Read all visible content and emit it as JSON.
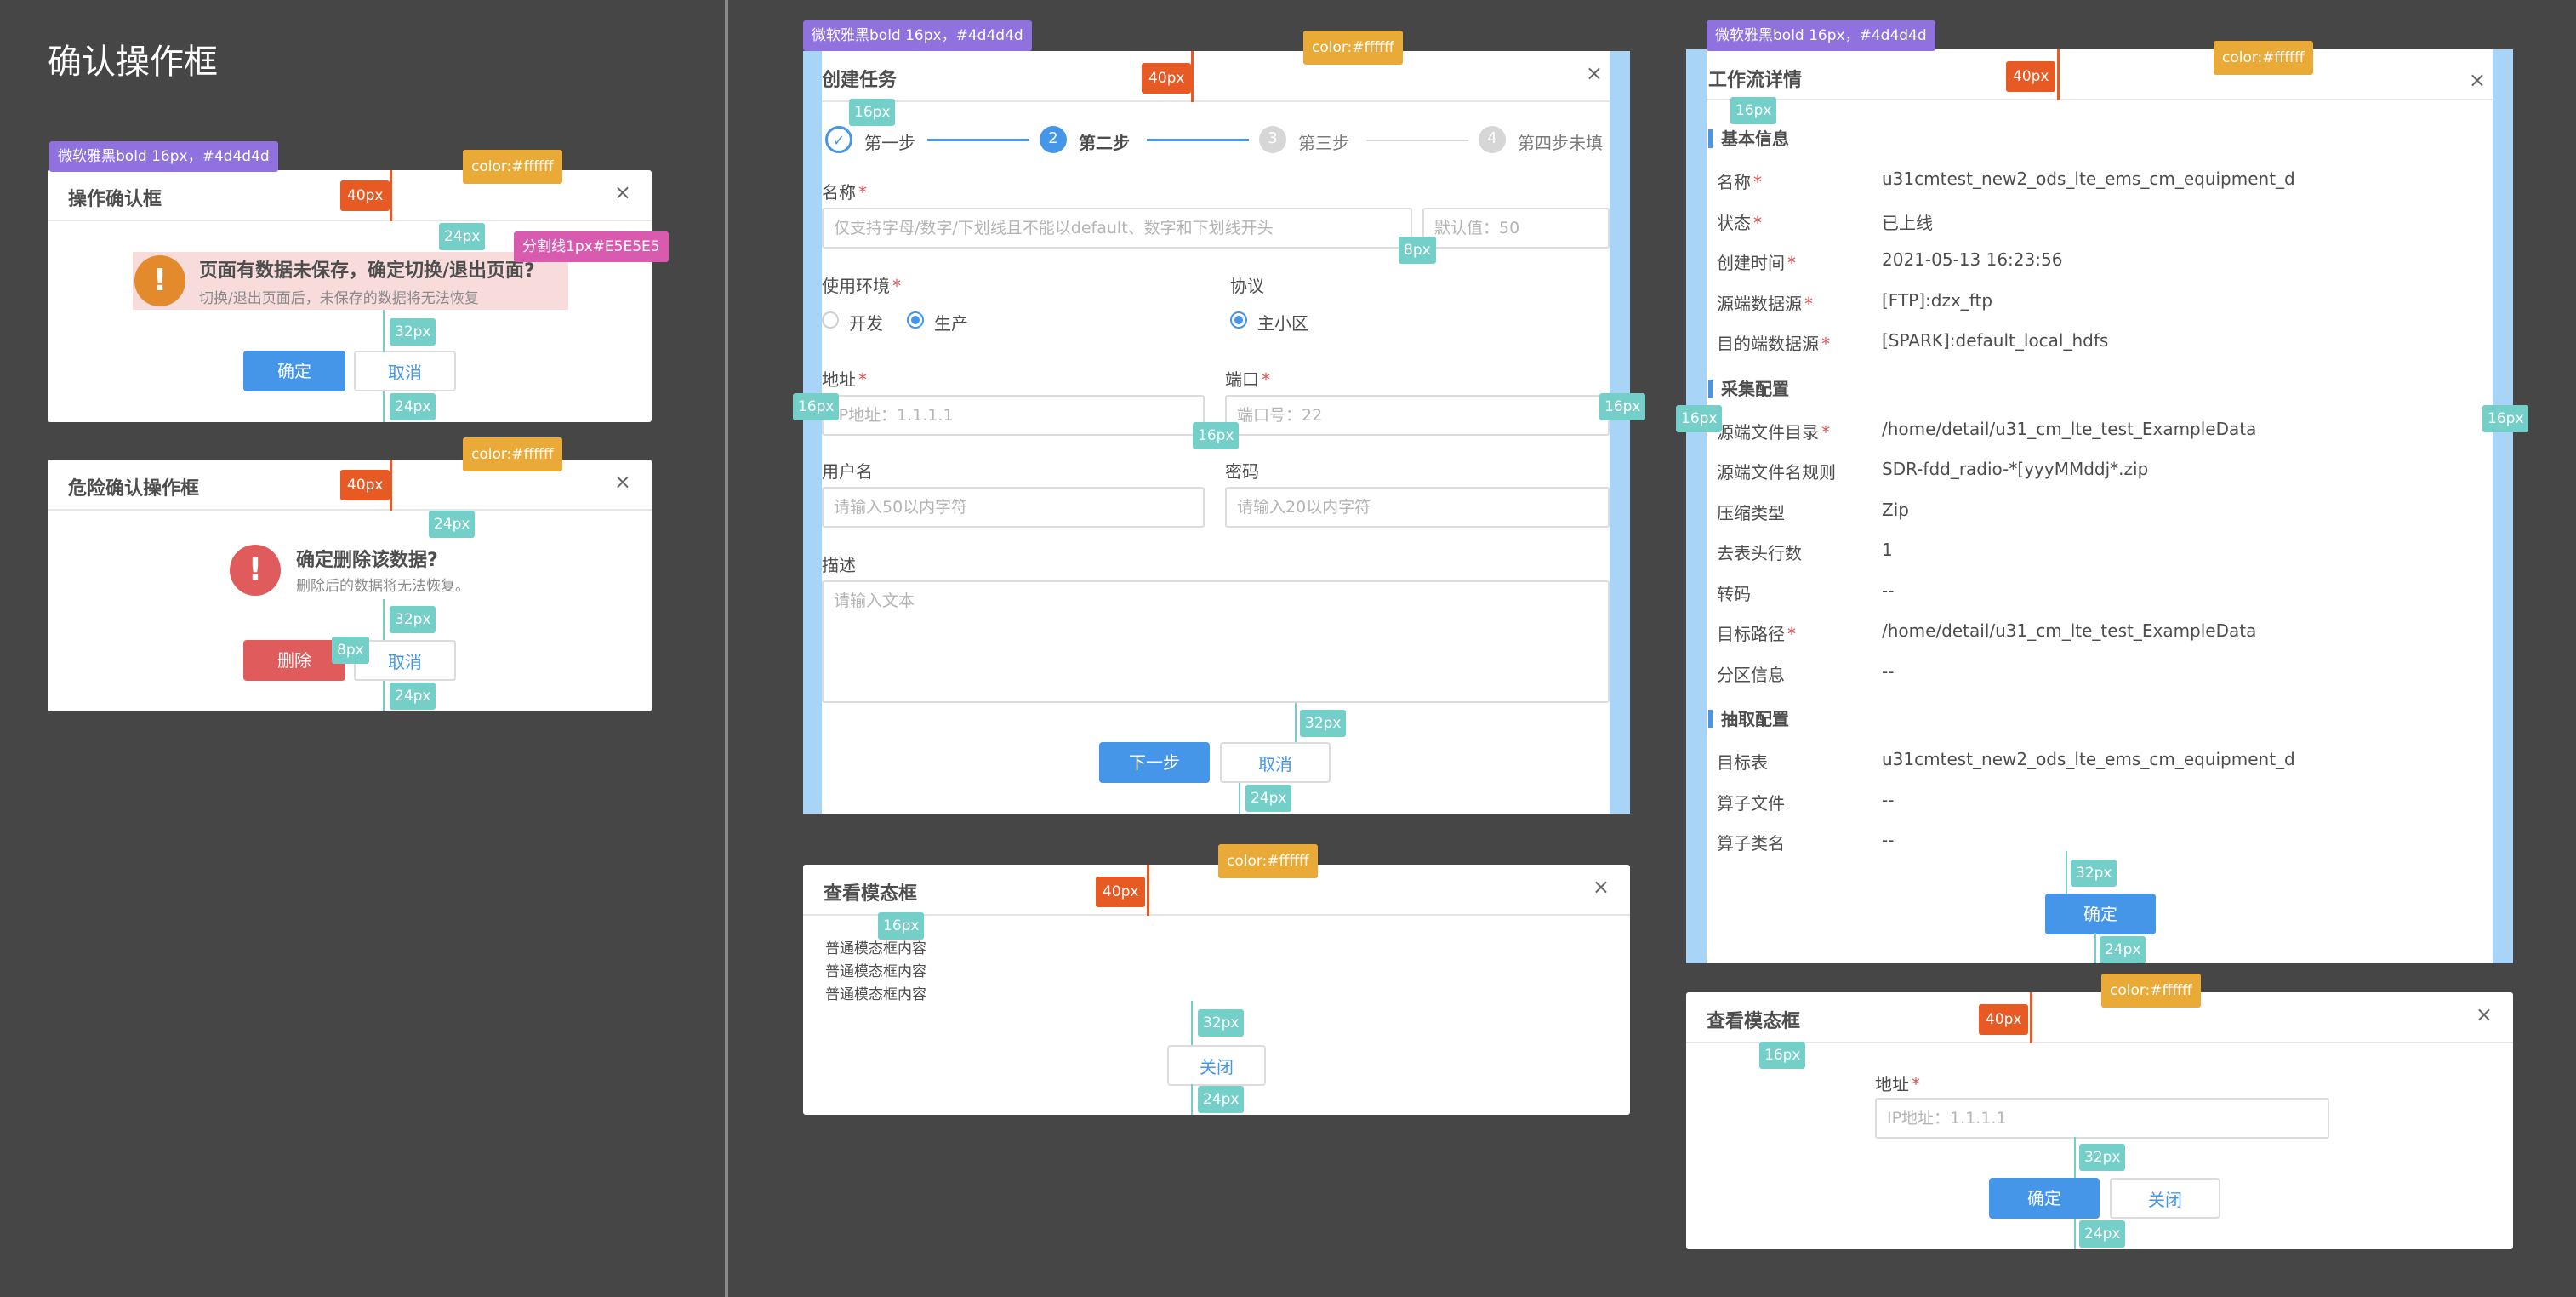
{
  "page_title": "确认操作框",
  "spec": {
    "font": "微软雅黑bold 16px，#4d4d4d",
    "color_white": "color:#ffffff",
    "divider": "分割线1px#E5E5E5",
    "px40": "40px",
    "px24": "24px",
    "px32": "32px",
    "px16": "16px",
    "px8": "8px"
  },
  "confirm": {
    "title": "操作确认框",
    "close": "×",
    "message": "页面有数据未保存，确定切换/退出页面?",
    "sub": "切换/退出页面后，未保存的数据将无法恢复",
    "ok": "确定",
    "cancel": "取消"
  },
  "danger": {
    "title": "危险确认操作框",
    "close": "×",
    "message": "确定删除该数据?",
    "sub": "删除后的数据将无法恢复。",
    "delete": "删除",
    "cancel": "取消"
  },
  "create": {
    "title": "创建任务",
    "close": "×",
    "steps": [
      {
        "num": "",
        "label": "第一步"
      },
      {
        "num": "2",
        "label": "第二步"
      },
      {
        "num": "3",
        "label": "第三步"
      },
      {
        "num": "4",
        "label": "第四步未填"
      }
    ],
    "name_label": "名称",
    "name_placeholder": "仅支持字母/数字/下划线且不能以default、数字和下划线开头",
    "name_default": "默认值：50",
    "env_label": "使用环境",
    "env_options": [
      "开发",
      "生产"
    ],
    "protocol_label": "协议",
    "protocol_option": "主小区",
    "addr_label": "地址",
    "addr_placeholder": "IP地址：1.1.1.1",
    "port_label": "端口",
    "port_placeholder": "端口号：22",
    "user_label": "用户名",
    "user_placeholder": "请输入50以内字符",
    "pwd_label": "密码",
    "pwd_placeholder": "请输入20以内字符",
    "desc_label": "描述",
    "desc_placeholder": "请输入文本",
    "next": "下一步",
    "cancel": "取消"
  },
  "view": {
    "title": "查看模态框",
    "close": "×",
    "lines": [
      "普通模态框内容",
      "普通模态框内容",
      "普通模态框内容"
    ],
    "close_btn": "关闭"
  },
  "workflow": {
    "title": "工作流详情",
    "close": "×",
    "sections": [
      {
        "title": "基本信息",
        "rows": [
          {
            "k": "名称",
            "req": true,
            "v": "u31cmtest_new2_ods_lte_ems_cm_equipment_d"
          },
          {
            "k": "状态",
            "req": true,
            "v": "已上线"
          },
          {
            "k": "创建时间",
            "req": true,
            "v": "2021-05-13 16:23:56"
          },
          {
            "k": "源端数据源",
            "req": true,
            "v": "[FTP]:dzx_ftp"
          },
          {
            "k": "目的端数据源",
            "req": true,
            "v": "[SPARK]:default_local_hdfs"
          }
        ]
      },
      {
        "title": "采集配置",
        "rows": [
          {
            "k": "源端文件目录",
            "req": true,
            "v": "/home/detail/u31_cm_lte_test_ExampleData"
          },
          {
            "k": "源端文件名规则",
            "req": false,
            "v": "SDR-fdd_radio-*[yyyMMddj*.zip"
          },
          {
            "k": "压缩类型",
            "req": false,
            "v": "Zip"
          },
          {
            "k": "去表头行数",
            "req": false,
            "v": "1"
          },
          {
            "k": "转码",
            "req": false,
            "v": "--"
          },
          {
            "k": "目标路径",
            "req": true,
            "v": "/home/detail/u31_cm_lte_test_ExampleData"
          },
          {
            "k": "分区信息",
            "req": false,
            "v": "--"
          }
        ]
      },
      {
        "title": "抽取配置",
        "rows": [
          {
            "k": "目标表",
            "req": false,
            "v": "u31cmtest_new2_ods_lte_ems_cm_equipment_d"
          },
          {
            "k": "算子文件",
            "req": false,
            "v": "--"
          },
          {
            "k": "算子类名",
            "req": false,
            "v": "--"
          }
        ]
      }
    ],
    "ok": "确定"
  },
  "view2": {
    "title": "查看模态框",
    "close": "×",
    "addr_label": "地址",
    "addr_placeholder": "IP地址：1.1.1.1",
    "ok": "确定",
    "close_btn": "关闭"
  },
  "colors": {
    "primary": "#4596e8",
    "danger": "#e05b5b",
    "warning": "#e28a2c",
    "text": "#4d4d4d",
    "divider": "#e5e5e5"
  }
}
